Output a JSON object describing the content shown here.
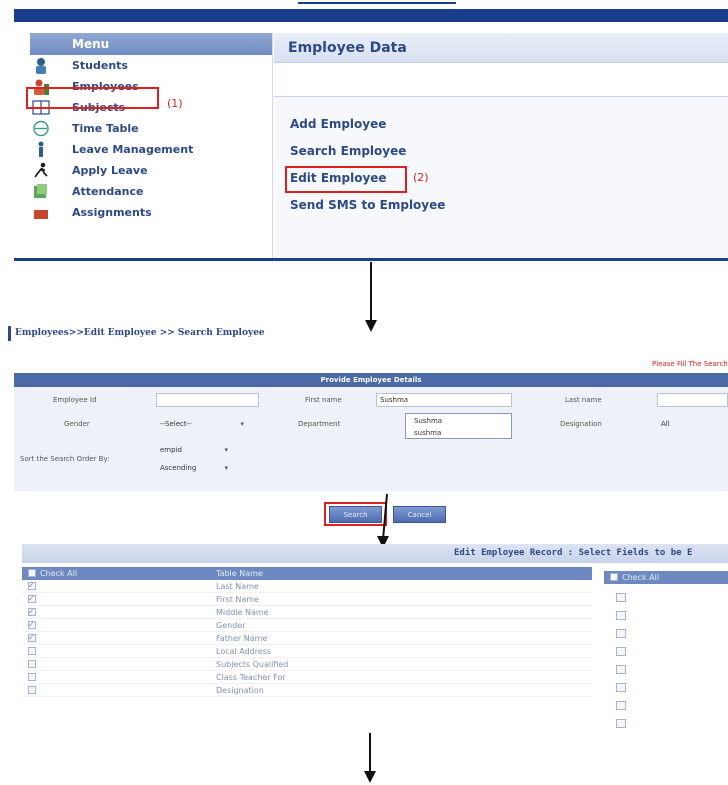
{
  "menu": {
    "title": "Menu",
    "items": [
      {
        "label": "Students",
        "icon": "student-icon"
      },
      {
        "label": "Employees",
        "icon": "employee-icon"
      },
      {
        "label": "Subjects",
        "icon": "book-icon"
      },
      {
        "label": "Time Table",
        "icon": "clock-icon"
      },
      {
        "label": "Leave Management",
        "icon": "person-icon"
      },
      {
        "label": "Apply Leave",
        "icon": "running-icon"
      },
      {
        "label": "Attendance",
        "icon": "attendance-icon"
      },
      {
        "label": "Assignments",
        "icon": "assignment-icon"
      }
    ]
  },
  "annotations": {
    "step1": "(1)",
    "step2": "(2)"
  },
  "employee_data": {
    "title": "Employee Data",
    "links": [
      "Add Employee",
      "Search Employee",
      "Edit Employee",
      "Send SMS to Employee"
    ]
  },
  "search_page": {
    "breadcrumb": "Employees>>Edit Employee >> Search Employee",
    "fill_note": "Please Fill The Search",
    "form_title": "Provide Employee Details",
    "labels": {
      "employee_id": "Employee Id",
      "first_name": "First name",
      "last_name": "Last name",
      "gender": "Gender",
      "department": "Department",
      "designation": "Designation",
      "sort_order": "Sort the Search Order By:"
    },
    "values": {
      "employee_id": "",
      "first_name": "Sushma",
      "last_name": "",
      "gender": "--Select--",
      "department": "",
      "designation": "All",
      "sort_field": "empid",
      "sort_direction": "Ascending"
    },
    "suggestions": [
      "Sushma",
      "sushma"
    ],
    "buttons": {
      "search": "Search",
      "cancel": "Cancel"
    }
  },
  "record": {
    "title": "Edit Employee Record : Select Fields to be E",
    "check_all": "Check All",
    "table_name_header": "Table Name",
    "rows": [
      {
        "label": "Last Name",
        "checked": true
      },
      {
        "label": "First Name",
        "checked": true
      },
      {
        "label": "Middle Name",
        "checked": true
      },
      {
        "label": "Gender",
        "checked": true
      },
      {
        "label": "Father Name",
        "checked": true
      },
      {
        "label": "Local Address",
        "checked": false
      },
      {
        "label": "Subjects Qualified",
        "checked": false
      },
      {
        "label": "Class Teacher For",
        "checked": false
      },
      {
        "label": "Designation",
        "checked": false
      }
    ],
    "right_check_all": "Check All"
  },
  "colors": {
    "accent": "#1a3e8c",
    "highlight": "#e02020",
    "link": "#2d4a86"
  }
}
